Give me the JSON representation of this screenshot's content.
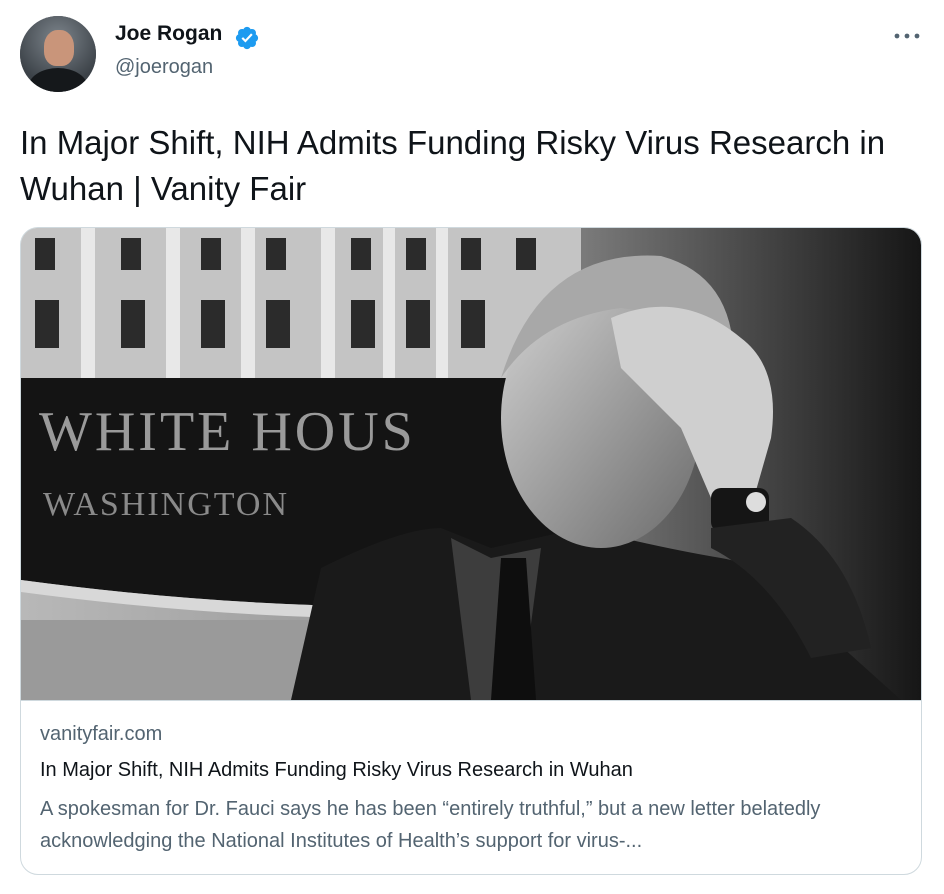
{
  "author": {
    "name": "Joe Rogan",
    "handle": "@joerogan",
    "verified_color": "#1d9bf0"
  },
  "tweet": {
    "text": "In Major Shift, NIH Admits Funding Risky Virus Research in Wuhan | Vanity Fair"
  },
  "card": {
    "image_sign_line1": "WHITE HOUS",
    "image_sign_line2": "WASHINGTON",
    "domain": "vanityfair.com",
    "title": "In Major Shift, NIH Admits Funding Risky Virus Research in Wuhan",
    "description": "A spokesman for Dr. Fauci says he has been “entirely truthful,” but a new letter belatedly acknowledging the National Institutes of Health’s support for virus-..."
  },
  "icons": {
    "verified": "verified-badge-icon",
    "more": "more-options-icon"
  },
  "colors": {
    "text_primary": "#0f1419",
    "text_secondary": "#536471",
    "border": "#cfd9de"
  }
}
